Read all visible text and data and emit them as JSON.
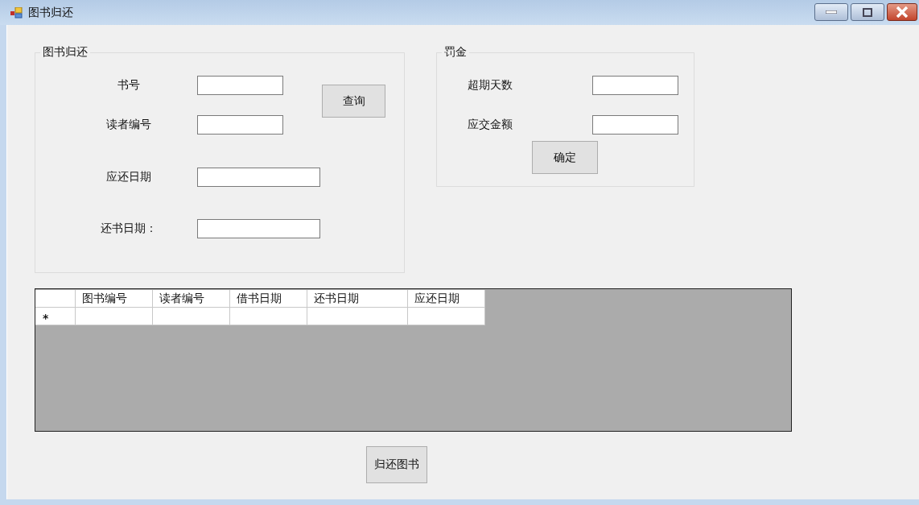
{
  "window": {
    "title": "图书归还"
  },
  "return_group": {
    "legend": "图书归还",
    "fields": [
      {
        "label": "书号",
        "kind": "short"
      },
      {
        "label": "读者编号",
        "kind": "short"
      },
      {
        "label": "应还日期",
        "kind": "wide"
      },
      {
        "label": "还书日期：",
        "kind": "wide"
      }
    ],
    "button": "查询"
  },
  "fine_group": {
    "legend": "罚金",
    "fields": [
      {
        "label": "超期天数"
      },
      {
        "label": "应交金额"
      }
    ],
    "button": "确定"
  },
  "grid": {
    "columns": [
      "图书编号",
      "读者编号",
      "借书日期",
      "还书日期",
      "应还日期"
    ],
    "new_row_marker": "*"
  },
  "return_button": "归还图书"
}
